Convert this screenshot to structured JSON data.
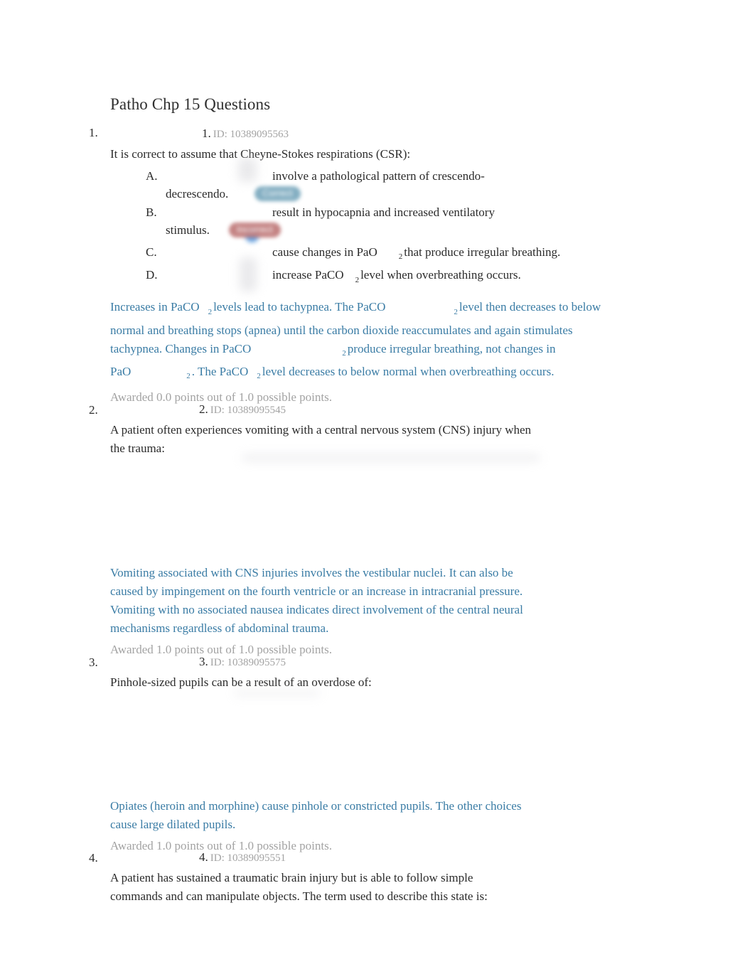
{
  "document": {
    "title": "Patho Chp 15 Questions"
  },
  "badges": {
    "correct_label": "Correct",
    "incorrect_label": "Incorrect",
    "correct_color": "#7ba9be",
    "incorrect_color": "#c07a7a",
    "selected_radio_color": "#4a90d9"
  },
  "colors": {
    "body_text": "#2b2b2b",
    "explanation_text": "#3a7ca5",
    "muted_text": "#a3a3a3",
    "page_background": "#ffffff"
  },
  "questions": [
    {
      "outer_marker": "1.",
      "inner_marker": "1.",
      "id_label": "ID: 10389095563",
      "stem": "It is correct to assume that Cheyne-Stokes respirations (CSR):",
      "options": [
        {
          "letter": "A.",
          "text_before": "involve a pathological pattern of crescendo-",
          "text_after": "decrescendo.",
          "subscript": "",
          "badge": "Correct"
        },
        {
          "letter": "B.",
          "text_before": "result in hypocapnia and increased ventilatory",
          "text_after": "stimulus.",
          "subscript": "",
          "badge": "Incorrect"
        },
        {
          "letter": "C.",
          "text_before": "cause changes in PaO",
          "subscript": "2",
          "text_after_sub": "that produce irregular breathing.",
          "badge": ""
        },
        {
          "letter": "D.",
          "text_before": "increase PaCO",
          "subscript": "2",
          "text_after_sub": "level when overbreathing occurs.",
          "badge": ""
        }
      ],
      "explanation_parts": {
        "p1": "Increases in PaCO",
        "s1": "2",
        "p2": "levels lead to tachypnea. The PaCO",
        "s2": "2",
        "p3": "level then decreases to below normal and breathing stops (apnea) until the carbon dioxide reaccumulates and again stimulates tachypnea. Changes in PaCO",
        "s3": "2",
        "p4": "produce irregular breathing, not changes in PaO",
        "s4": "2",
        "p5": ". The PaCO",
        "s5": "2",
        "p6": "level decreases to below normal when overbreathing occurs."
      },
      "awarded": "Awarded 0.0 points out of 1.0 possible points."
    },
    {
      "outer_marker": "2.",
      "inner_marker": "2.",
      "id_label": "ID: 10389095545",
      "stem": "A patient often experiences vomiting with a central nervous system (CNS) injury when the trauma:",
      "options": [],
      "explanation": "Vomiting associated with CNS injuries involves the vestibular nuclei. It can also be caused by impingement on the fourth ventricle or an increase in intracranial pressure. Vomiting with no associated nausea indicates direct involvement of the central neural mechanisms regardless of abdominal trauma.",
      "awarded": "Awarded 1.0 points out of 1.0 possible points."
    },
    {
      "outer_marker": "3.",
      "inner_marker": "3.",
      "id_label": "ID: 10389095575",
      "stem": "Pinhole-sized pupils can be a result of an overdose of:",
      "options": [],
      "explanation": "Opiates (heroin and morphine) cause pinhole or constricted pupils. The other choices cause large dilated pupils.",
      "awarded": "Awarded 1.0 points out of 1.0 possible points."
    },
    {
      "outer_marker": "4.",
      "inner_marker": "4.",
      "id_label": "ID: 10389095551",
      "stem": "A patient has sustained a traumatic brain injury but is able to follow simple commands and can manipulate objects. The term used to describe this state is:",
      "options": [],
      "explanation": "",
      "awarded": ""
    }
  ]
}
